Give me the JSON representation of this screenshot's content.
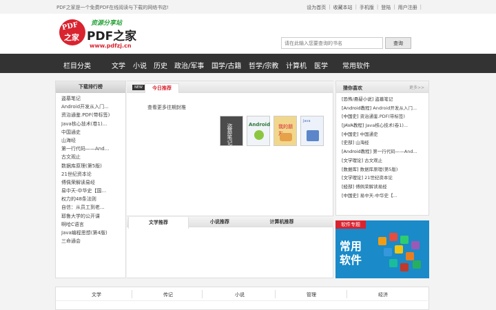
{
  "topbar": {
    "tagline": "PDF之家是一个免费PDF在线阅读与下载的网络书店!",
    "links": [
      "设为首页",
      "收藏本站",
      "手机版",
      "登陆",
      "用户注册"
    ]
  },
  "logo": {
    "slogan": "资源分享站",
    "brand": "PDF之家",
    "url": "www.pdfzj.cn",
    "badge_top": "PDF",
    "badge_bottom": "之家"
  },
  "search": {
    "placeholder": "请在此输入您要查询的书名",
    "button": "查询"
  },
  "nav": {
    "items": [
      "栏目分类",
      "文学",
      "小说",
      "历史",
      "政治/军事",
      "国学/古籍",
      "哲学/宗教",
      "计算机",
      "医学",
      "常用软件"
    ]
  },
  "left": {
    "title": "下载排行榜",
    "items": [
      "盗墓笔记",
      "Android开发从入门...",
      "资治通鉴.PDF(带标签)",
      "Java核心技术(卷1)...",
      "中国通史",
      "山海经",
      "第一行代码——And...",
      "古文观止",
      "数据库原理(第5版)",
      "21世纪资本论",
      "傅佩荣解读易经",
      "易中天-中华史【国...",
      "权力的48条法则",
      "自信：从员工到老...",
      "耶鲁大学的公开课",
      "啊哈C语言",
      "Java编程思想(第4版)",
      "三命通会"
    ]
  },
  "middle": {
    "badge": "NEW",
    "tab": "今日推荐",
    "prev_link": "查看更多往期封推",
    "books": [
      {
        "title": "盗墓笔记"
      },
      {
        "title": "Android"
      },
      {
        "title": "我的朋友"
      },
      {
        "title": "Java"
      }
    ],
    "bottom_tabs": [
      "文学推荐",
      "小说推荐",
      "计算机推荐"
    ]
  },
  "right": {
    "title": "猜你喜欢",
    "more": "更多>>",
    "items": [
      {
        "cat": "[恐怖/悬疑小说]",
        "name": "盗墓笔记"
      },
      {
        "cat": "[Android教程]",
        "name": "Android开发从入门..."
      },
      {
        "cat": "[中国史]",
        "name": "资治通鉴.PDF(带标签)"
      },
      {
        "cat": "[JAVA教程]",
        "name": "Java核心技术(卷1)..."
      },
      {
        "cat": "[中国史]",
        "name": "中国通史"
      },
      {
        "cat": "[史部]",
        "name": "山海经"
      },
      {
        "cat": "[Android教程]",
        "name": "第一行代码——And..."
      },
      {
        "cat": "[文学理论]",
        "name": "古文观止"
      },
      {
        "cat": "[数据库]",
        "name": "数据库原理(第5版)"
      },
      {
        "cat": "[文学理论]",
        "name": "21世纪资本论"
      },
      {
        "cat": "[经部]",
        "name": "傅佩荣解读易经"
      },
      {
        "cat": "[中国史]",
        "name": "易中天-中华史【..."
      }
    ]
  },
  "software": {
    "label": "软件专题",
    "title": "常用软件"
  },
  "categories": {
    "items": [
      "文学",
      "传记",
      "小说",
      "管理",
      "经济"
    ]
  },
  "colors": {
    "accent": "#d9232f",
    "nav_bg": "#333333",
    "software_bg": "#1a8ac9"
  }
}
